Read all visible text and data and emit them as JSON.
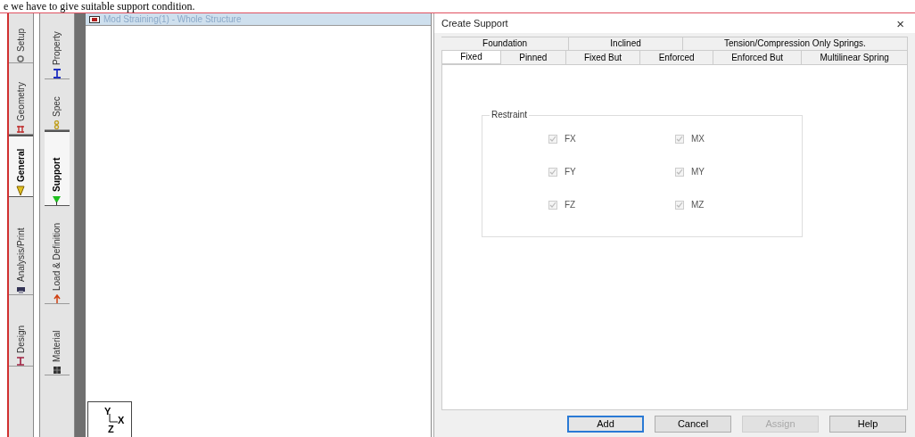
{
  "caption": "e we have to give suitable support condition.",
  "page_tabs": [
    {
      "label": "Setup",
      "selected": false
    },
    {
      "label": "Geometry",
      "selected": false
    },
    {
      "label": "General",
      "selected": true
    },
    {
      "label": "Analysis/Print",
      "selected": false
    },
    {
      "label": "Design",
      "selected": false
    }
  ],
  "sub_tabs": [
    {
      "label": "Property",
      "selected": false
    },
    {
      "label": "Spec",
      "selected": false
    },
    {
      "label": "Support",
      "selected": true
    },
    {
      "label": "Load & Definition",
      "selected": false
    },
    {
      "label": "Material",
      "selected": false
    }
  ],
  "view": {
    "title": "Mod Straining(1) - Whole Structure",
    "axes": [
      "Y",
      "X",
      "Z"
    ]
  },
  "dialog": {
    "title": "Create Support",
    "close": "×",
    "tab_rows": [
      [
        {
          "label": "Foundation",
          "selected": false
        },
        {
          "label": "Inclined",
          "selected": false
        },
        {
          "label": "Tension/Compression Only Springs.",
          "selected": false
        }
      ],
      [
        {
          "label": "Fixed",
          "selected": true
        },
        {
          "label": "Pinned",
          "selected": false
        },
        {
          "label": "Fixed But",
          "selected": false
        },
        {
          "label": "Enforced",
          "selected": false
        },
        {
          "label": "Enforced But",
          "selected": false
        },
        {
          "label": "Multilinear Spring",
          "selected": false
        }
      ]
    ],
    "group": {
      "title": "Restraint",
      "checks": [
        {
          "label": "FX",
          "checked": true,
          "disabled": true
        },
        {
          "label": "MX",
          "checked": true,
          "disabled": true
        },
        {
          "label": "FY",
          "checked": true,
          "disabled": true
        },
        {
          "label": "MY",
          "checked": true,
          "disabled": true
        },
        {
          "label": "FZ",
          "checked": true,
          "disabled": true
        },
        {
          "label": "MZ",
          "checked": true,
          "disabled": true
        }
      ]
    },
    "buttons": [
      {
        "label": "Add",
        "disabled": false,
        "default": true
      },
      {
        "label": "Cancel",
        "disabled": false,
        "default": false
      },
      {
        "label": "Assign",
        "disabled": true,
        "default": false
      },
      {
        "label": "Help",
        "disabled": false,
        "default": false
      }
    ]
  }
}
